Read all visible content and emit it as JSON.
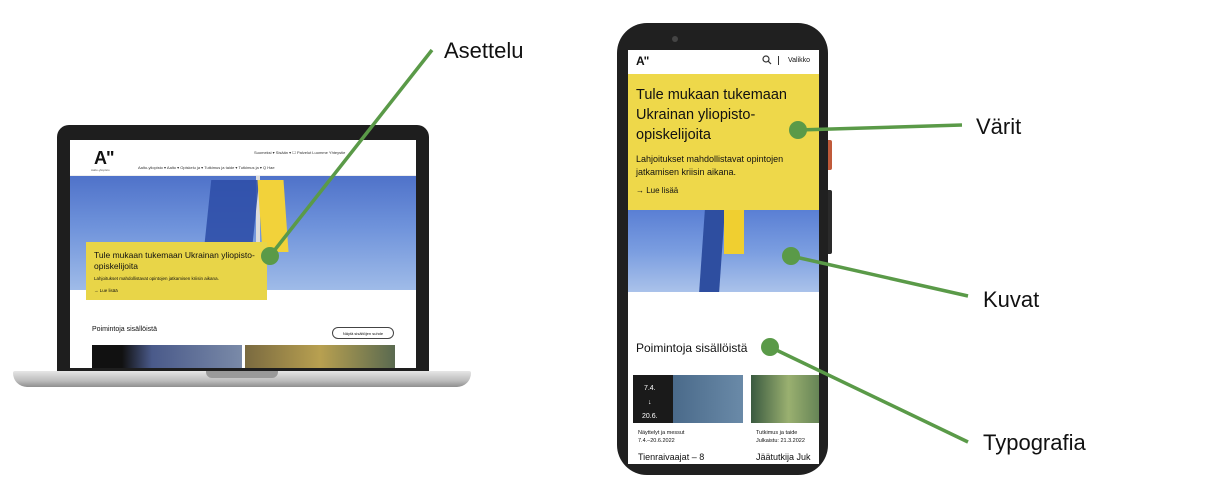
{
  "labels": {
    "layout": "Asettelu",
    "colors": "Värit",
    "images": "Kuvat",
    "typography": "Typografia"
  },
  "laptop": {
    "logo": "A\"",
    "logo_sub": "Aalto-yliopisto",
    "top_links": "Suomeksi ▾   Sisään ▾   ☐ Palvelut   Luomme   Yhteystie",
    "menu": "Aalto-yliopisto ▾    Aalto ▾    Opiskelu ja ▾    Tutkimus ja taide ▾    Tutkimus ja   ▾    Q  Hae",
    "hero_title": "Tule mukaan tukemaan Ukrainan yliopisto-opiskelijoita",
    "hero_sub": "Lahjoitukset mahdollistavat opintojen jatkamisen kriisin aikana.",
    "hero_link": "→ Lue lisää",
    "section_title": "Poimintoja sisällöistä",
    "section_button": "Näytä sisältöjen suhde"
  },
  "phone": {
    "logo": "A\"",
    "menu_label": "Valikko",
    "hero_title": "Tule mukaan tukemaan Ukrainan yliopisto-opiskelijoita",
    "hero_sub": "Lahjoitukset mahdollistavat opintojen jatkamisen kriisin aikana.",
    "hero_link": "→ Lue lisää",
    "section_title": "Poimintoja sisällöistä",
    "cards": [
      {
        "date": "7.4.\n↓\n20.6.",
        "category": "Näyttelyt ja messut",
        "meta": "7.4.–20.6.2022",
        "title": "Tienraivaajat – 8"
      },
      {
        "category": "Tutkimus ja taide",
        "meta": "Julkaistu: 21.3.2022",
        "title": "Jäätutkija Juk"
      }
    ]
  },
  "colors": {
    "callout": "#5a9a48",
    "brand_yellow": "#eed84a"
  }
}
